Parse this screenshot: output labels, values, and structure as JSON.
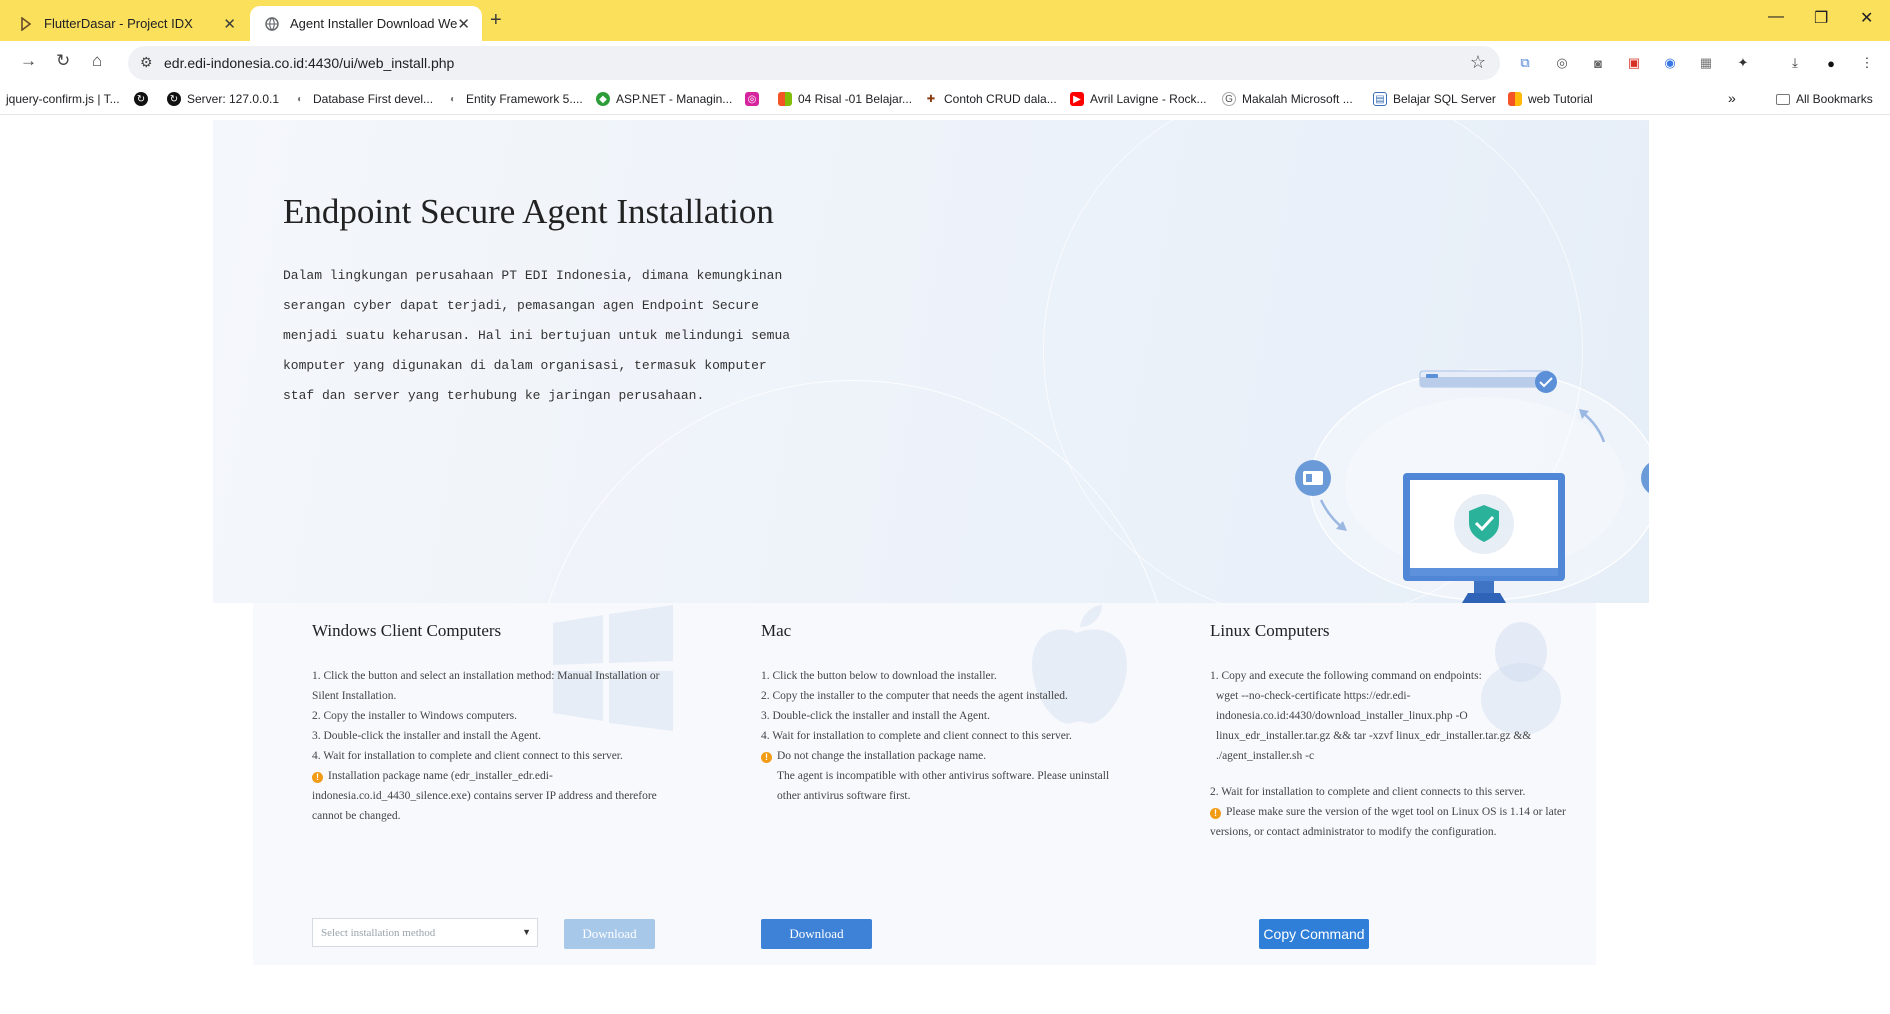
{
  "browser": {
    "tabs": [
      {
        "title": "FlutterDasar - Project IDX",
        "active": false
      },
      {
        "title": "Agent Installer Download Webpage",
        "active": true
      }
    ],
    "url": "edr.edi-indonesia.co.id:4430/ui/web_install.php",
    "bookmarks": [
      "jquery-confirm.js | T...",
      "",
      "Server: 127.0.0.1",
      "Database First devel...",
      "Entity Framework 5....",
      "ASP.NET - Managin...",
      "",
      "04 Risal -01 Belajar...",
      "Contoh CRUD dala...",
      "Avril Lavigne - Rock...",
      "Makalah Microsoft ...",
      "Belajar SQL Server",
      "web Tutorial"
    ],
    "all_bookmarks": "All Bookmarks",
    "colors": {
      "tabstrip": "#fbe05b"
    }
  },
  "hero": {
    "title": "Endpoint Secure Agent Installation",
    "description": "Dalam lingkungan perusahaan PT EDI Indonesia, dimana kemungkinan serangan cyber dapat terjadi, pemasangan agen Endpoint Secure menjadi suatu keharusan. Hal ini bertujuan untuk melindungi semua komputer yang digunakan di dalam organisasi, termasuk komputer staf dan server yang terhubung ke jaringan perusahaan."
  },
  "windows": {
    "title": "Windows Client Computers",
    "steps": [
      "1. Click the button and select an installation method: Manual Installation or Silent Installation.",
      "2. Copy the installer to Windows computers.",
      "3. Double-click the installer and install the Agent.",
      "4. Wait for installation to complete and client connect to this server."
    ],
    "warning": "Installation package name (edr_installer_edr.edi-indonesia.co.id_4430_silence.exe) contains server IP address and therefore cannot be changed.",
    "select_placeholder": "Select installation method",
    "download_label": "Download"
  },
  "mac": {
    "title": "Mac",
    "steps": [
      "1. Click the button below to download the installer.",
      "2. Copy the installer to the computer that needs the agent installed.",
      "3. Double-click the installer and install the Agent.",
      "4. Wait for installation to complete and client connect to this server."
    ],
    "warning": "Do not change the installation package name.",
    "note": "The agent is incompatible with other antivirus software. Please uninstall other antivirus software first.",
    "download_label": "Download"
  },
  "linux": {
    "title": "Linux Computers",
    "step1": "1. Copy and execute the following command on endpoints:",
    "command": "wget --no-check-certificate https://edr.edi-indonesia.co.id:4430/download_installer_linux.php -O linux_edr_installer.tar.gz && tar -xzvf linux_edr_installer.tar.gz && ./agent_installer.sh -c",
    "step2": "2. Wait for installation to complete and client connects to this server.",
    "warning": "Please make sure the version of the wget tool on Linux OS is 1.14 or later versions, or contact administrator to modify the configuration.",
    "copy_label": "Copy Command"
  },
  "colors": {
    "primary_button": "#3d82d6",
    "disabled_button": "#a8c8ea",
    "warning": "#f29b15"
  }
}
